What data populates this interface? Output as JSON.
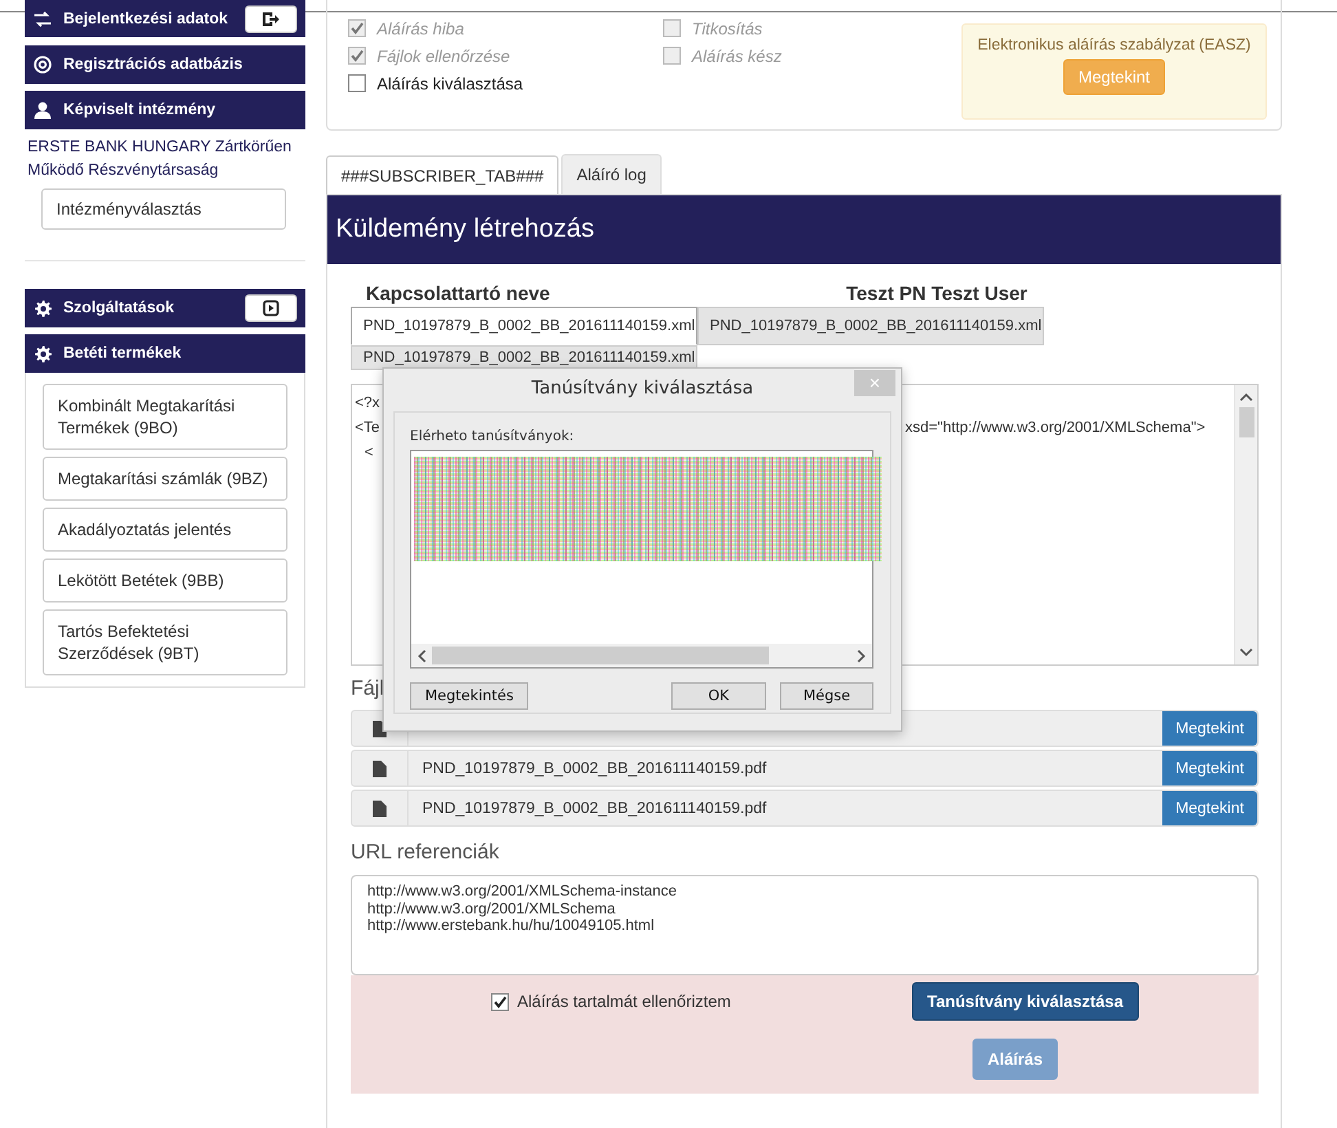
{
  "sidebar": {
    "login": {
      "label": "Bejelentkezési adatok"
    },
    "registry": {
      "label": "Regisztrációs adatbázis"
    },
    "institution": {
      "label": "Képviselt intézmény",
      "name": "ERSTE BANK HUNGARY Zártkörűen Működő Részvénytársaság",
      "button": "Intézményválasztás"
    },
    "services": {
      "label": "Szolgáltatások"
    },
    "products": {
      "label": "Betéti termékek",
      "items": [
        {
          "label": "Kombinált Megtakarítási Termékek (9BO)"
        },
        {
          "label": "Megtakarítási számlák (9BZ)"
        },
        {
          "label": "Akadályoztatás jelentés"
        },
        {
          "label": "Lekötött Betétek (9BB)"
        },
        {
          "label": "Tartós Befektetési Szerződések (9BT)"
        }
      ]
    }
  },
  "status_panel": {
    "checkboxes": [
      {
        "label": "Aláírás hiba",
        "checked": true,
        "disabled": true
      },
      {
        "label": "Titkosítás",
        "checked": false,
        "disabled": true
      },
      {
        "label": "Fájlok ellenőrzése",
        "checked": true,
        "disabled": true
      },
      {
        "label": "Aláírás kész",
        "checked": false,
        "disabled": true
      },
      {
        "label": "Aláírás kiválasztása",
        "checked": false,
        "disabled": false
      }
    ],
    "notice": {
      "text": "Elektronikus aláírás szabályzat (EASZ)",
      "button": "Megtekint"
    }
  },
  "tabs": [
    {
      "label": "###SUBSCRIBER_TAB###",
      "selected": true
    },
    {
      "label": "Aláíró log",
      "selected": false
    }
  ],
  "panel": {
    "title": "Küldemény létrehozás",
    "contact_label": "Kapcsolattartó neve",
    "contact_name": "Teszt PN Teszt User",
    "file_tabs": [
      {
        "label": "PND_10197879_B_0002_BB_201611140159.xml",
        "selected": true
      },
      {
        "label": "PND_10197879_B_0002_BB_201611140159.xml",
        "selected": false
      },
      {
        "label": "PND_10197879_B_0002_BB_201611140159.xml",
        "selected": false
      }
    ],
    "xml_lines": [
      {
        "left": "<?x"
      },
      {
        "left": "<Te",
        "right": "xsd=\"http://www.w3.org/2001/XMLSchema\">"
      },
      {
        "left": "<"
      }
    ],
    "files_heading": "Fájl",
    "files": [
      {
        "button": "Megtekint"
      },
      {
        "name": "PND_10197879_B_0002_BB_201611140159.pdf",
        "button": "Megtekint"
      },
      {
        "name": "PND_10197879_B_0002_BB_201611140159.pdf",
        "button": "Megtekint"
      }
    ],
    "url_heading": "URL referenciák",
    "urls": [
      "http://www.w3.org/2001/XMLSchema-instance",
      "http://www.w3.org/2001/XMLSchema",
      "http://www.erstebank.hu/hu/10049105.html"
    ],
    "confirm": {
      "label": "Aláírás tartalmát ellenőriztem",
      "checked": true
    },
    "select_button": {
      "label": "Tanúsítvány kiválasztása"
    },
    "sign_button": {
      "label": "Aláírás",
      "disabled": true
    }
  },
  "dialog": {
    "title": "Tanúsítvány kiválasztása",
    "close": "×",
    "list_label": "Elérheto tanúsítványok:",
    "view_button": "Megtekintés",
    "ok_button": "OK",
    "cancel_button": "Mégse"
  }
}
